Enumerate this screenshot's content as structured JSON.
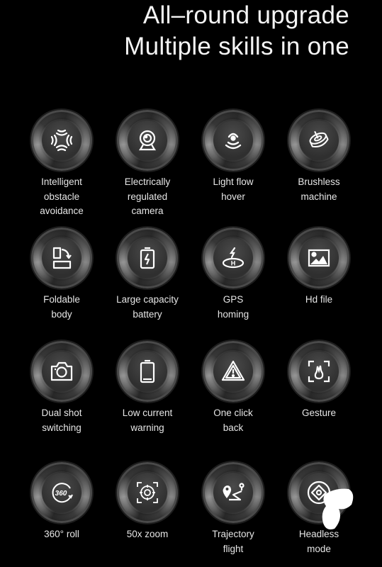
{
  "headline": {
    "line1": "All–round upgrade",
    "line2": "Multiple skills in one"
  },
  "colors": {
    "background": "#000000",
    "text": "#ffffff",
    "button_ring": "#5a5a5a"
  },
  "features": [
    {
      "icon": "obstacle-avoidance-icon",
      "lines": [
        "Intelligent",
        "obstacle",
        "avoidance"
      ]
    },
    {
      "icon": "webcam-icon",
      "lines": [
        "Electrically",
        "regulated",
        "camera"
      ]
    },
    {
      "icon": "optical-flow-icon",
      "lines": [
        "Light flow",
        "hover"
      ]
    },
    {
      "icon": "brushless-motor-icon",
      "lines": [
        "Brushless",
        "machine"
      ]
    },
    {
      "icon": "fold-icon",
      "lines": [
        "Foldable",
        "body"
      ]
    },
    {
      "icon": "battery-charge-icon",
      "lines": [
        "Large capacity",
        "battery"
      ]
    },
    {
      "icon": "helipad-return-icon",
      "lines": [
        "GPS",
        "homing"
      ]
    },
    {
      "icon": "image-icon",
      "lines": [
        "Hd file"
      ]
    },
    {
      "icon": "camera-icon",
      "lines": [
        "Dual shot",
        "switching"
      ]
    },
    {
      "icon": "low-battery-icon",
      "lines": [
        "Low current",
        "warning"
      ]
    },
    {
      "icon": "warning-triangle-icon",
      "lines": [
        "One click",
        "back"
      ]
    },
    {
      "icon": "gesture-hand-icon",
      "lines": [
        "Gesture"
      ]
    },
    {
      "icon": "rotate-360-icon",
      "lines": [
        "360° roll"
      ]
    },
    {
      "icon": "zoom-target-icon",
      "lines": [
        "50x zoom"
      ]
    },
    {
      "icon": "route-pin-icon",
      "lines": [
        "Trajectory",
        "flight"
      ]
    },
    {
      "icon": "headless-mode-icon",
      "lines": [
        "Headless",
        "mode"
      ]
    }
  ]
}
